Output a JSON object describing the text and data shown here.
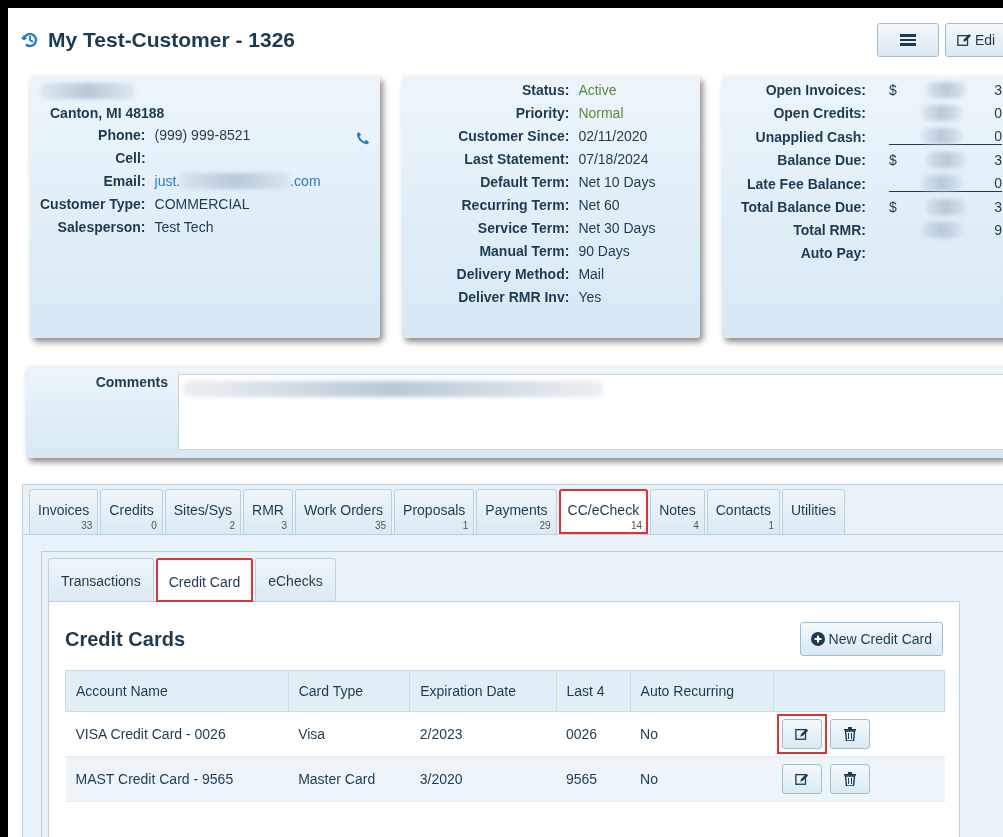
{
  "header": {
    "title": "My Test-Customer - 1326",
    "buttons": [
      {
        "kind": "menu"
      },
      {
        "kind": "edit",
        "label": "Edi"
      }
    ]
  },
  "contact_card": {
    "city": "Canton, MI 48188",
    "fields": [
      {
        "label": "Phone:",
        "kind": "phone",
        "value": "(999) 999-8521"
      },
      {
        "label": "Cell:",
        "kind": "blank"
      },
      {
        "label": "Email:",
        "kind": "email",
        "prefix": "just.",
        "suffix": ".com"
      },
      {
        "label": "Customer Type:",
        "kind": "text",
        "value": "COMMERCIAL"
      },
      {
        "label": "Salesperson:",
        "kind": "text",
        "value": "Test Tech"
      }
    ]
  },
  "status_card": {
    "fields": [
      {
        "label": "Status:",
        "value": "Active",
        "kind": "status"
      },
      {
        "label": "Priority:",
        "value": "Normal",
        "kind": "status"
      },
      {
        "label": "Customer Since:",
        "value": "02/11/2020",
        "kind": "text"
      },
      {
        "label": "Last Statement:",
        "value": "07/18/2024",
        "kind": "text"
      },
      {
        "label": "Default Term:",
        "value": "Net 10 Days",
        "kind": "text"
      },
      {
        "label": "Recurring Term:",
        "value": "Net 60",
        "kind": "text"
      },
      {
        "label": "Service Term:",
        "value": "Net 30 Days",
        "kind": "text"
      },
      {
        "label": "Manual Term:",
        "value": "90 Days",
        "kind": "text"
      },
      {
        "label": "Delivery Method:",
        "value": "Mail",
        "kind": "text"
      },
      {
        "label": "Deliver RMR Inv:",
        "value": "Yes",
        "kind": "text"
      }
    ]
  },
  "balance_card": {
    "fields": [
      {
        "label": "Open Invoices:",
        "prefix": "$",
        "suffix": "3",
        "underline": false
      },
      {
        "label": "Open Credits:",
        "suffix": "0",
        "underline": false
      },
      {
        "label": "Unapplied Cash:",
        "suffix": "0",
        "underline": true
      },
      {
        "label": "Balance Due:",
        "prefix": "$",
        "suffix": "3",
        "underline": false
      },
      {
        "label": "Late Fee Balance:",
        "suffix": "0",
        "underline": true
      },
      {
        "label": "Total Balance Due:",
        "prefix": "$",
        "suffix": "3",
        "underline": false
      },
      {
        "label": "Total RMR:",
        "suffix": "9",
        "underline": false
      },
      {
        "label": "Auto Pay:"
      }
    ]
  },
  "comments": {
    "label": "Comments"
  },
  "tabs": [
    {
      "label": "Invoices",
      "count": "33",
      "selected": false,
      "highlighted": false
    },
    {
      "label": "Credits",
      "count": "0",
      "selected": false,
      "highlighted": false
    },
    {
      "label": "Sites/Sys",
      "count": "2",
      "selected": false,
      "highlighted": false
    },
    {
      "label": "RMR",
      "count": "3",
      "selected": false,
      "highlighted": false
    },
    {
      "label": "Work Orders",
      "count": "35",
      "selected": false,
      "highlighted": false
    },
    {
      "label": "Proposals",
      "count": "1",
      "selected": false,
      "highlighted": false
    },
    {
      "label": "Payments",
      "count": "29",
      "selected": false,
      "highlighted": false
    },
    {
      "label": "CC/eCheck",
      "count": "14",
      "selected": true,
      "highlighted": true
    },
    {
      "label": "Notes",
      "count": "4",
      "selected": false,
      "highlighted": false
    },
    {
      "label": "Contacts",
      "count": "1",
      "selected": false,
      "highlighted": false
    },
    {
      "label": "Utilities",
      "selected": false,
      "highlighted": false
    }
  ],
  "subtabs": [
    {
      "label": "Transactions",
      "selected": false,
      "highlighted": false
    },
    {
      "label": "Credit Card",
      "selected": true,
      "highlighted": true
    },
    {
      "label": "eChecks",
      "selected": false,
      "highlighted": false
    }
  ],
  "credit_cards": {
    "title": "Credit Cards",
    "new_button": "New Credit Card",
    "columns": [
      "Account Name",
      "Card Type",
      "Expiration Date",
      "Last 4",
      "Auto Recurring"
    ],
    "rows": [
      {
        "cells": [
          "VISA Credit Card - 0026",
          "Visa",
          "2/2023",
          "0026",
          "No"
        ],
        "edit_highlighted": true
      },
      {
        "cells": [
          "MAST Credit Card - 9565",
          "Master Card",
          "3/2020",
          "9565",
          "No"
        ],
        "edit_highlighted": false
      }
    ]
  }
}
